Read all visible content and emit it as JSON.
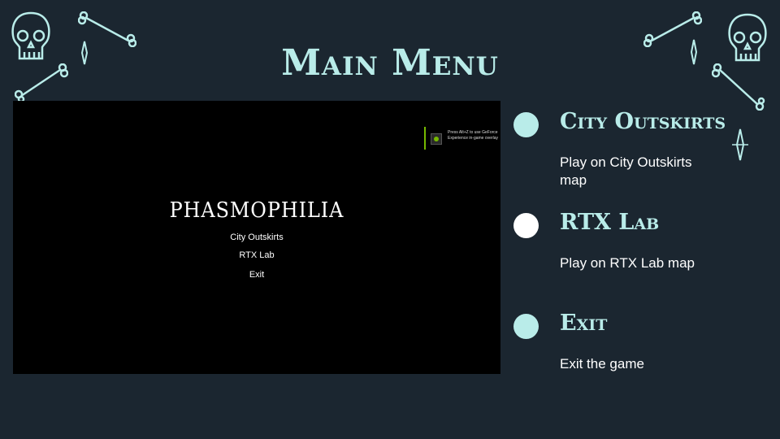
{
  "slide": {
    "title": "Main Menu",
    "colors": {
      "background": "#1b2630",
      "accent": "#b9ece9",
      "highlight": "#ffffff"
    }
  },
  "screenshot": {
    "game_title": "PHASMOPHILIA",
    "menu": [
      "City Outskirts",
      "RTX Lab",
      "Exit"
    ],
    "overlay_text": "Press Alt+Z to use GeForce Experience in-game overlay"
  },
  "items": [
    {
      "title": "City Outskirts",
      "description": "Play on City Outskirts map",
      "bullet_color": "#b9ece9"
    },
    {
      "title": "RTX Lab",
      "description": "Play on RTX Lab map",
      "bullet_color": "#ffffff"
    },
    {
      "title": "Exit",
      "description": "Exit the game",
      "bullet_color": "#b9ece9"
    }
  ],
  "decorations": [
    "skull-icon",
    "crossbones-icon",
    "sparkle-icon"
  ]
}
